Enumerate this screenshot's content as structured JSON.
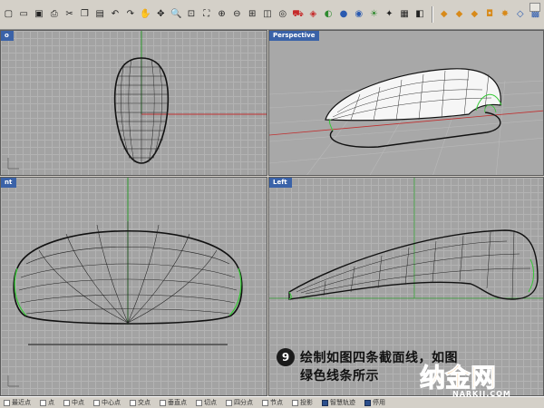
{
  "toolbar": {
    "buttons": [
      {
        "icon": "new-file-icon",
        "glyph": "▢"
      },
      {
        "icon": "open-folder-icon",
        "glyph": "▭"
      },
      {
        "icon": "save-icon",
        "glyph": "▣"
      },
      {
        "icon": "print-icon",
        "glyph": "⎙"
      },
      {
        "icon": "cut-icon",
        "glyph": "✂"
      },
      {
        "icon": "copy-icon",
        "glyph": "❐"
      },
      {
        "icon": "paste-icon",
        "glyph": "▤"
      },
      {
        "icon": "undo-icon",
        "glyph": "↶"
      },
      {
        "icon": "redo-icon",
        "glyph": "↷"
      },
      {
        "icon": "pan-hand-icon",
        "glyph": "✋"
      },
      {
        "icon": "rotate-view-icon",
        "glyph": "✥"
      },
      {
        "icon": "zoom-icon",
        "glyph": "🔍"
      },
      {
        "icon": "zoom-window-icon",
        "glyph": "⊡"
      },
      {
        "icon": "zoom-extents-icon",
        "glyph": "⛶"
      },
      {
        "icon": "zoom-selected-icon",
        "glyph": "⊕"
      },
      {
        "icon": "zoom-out-icon",
        "glyph": "⊖"
      },
      {
        "icon": "grid-icon",
        "glyph": "⊞"
      },
      {
        "icon": "layer-icon",
        "glyph": "◫"
      },
      {
        "icon": "bulb-icon",
        "glyph": "◎"
      },
      {
        "icon": "car-icon",
        "glyph": "⛟"
      },
      {
        "icon": "properties-icon",
        "glyph": "◈"
      },
      {
        "icon": "render-icon",
        "glyph": "◐"
      },
      {
        "icon": "material-icon",
        "glyph": "●"
      },
      {
        "icon": "sphere-icon",
        "glyph": "◉"
      },
      {
        "icon": "light-icon",
        "glyph": "☀"
      },
      {
        "icon": "snap-icon",
        "glyph": "✦"
      },
      {
        "icon": "options-icon",
        "glyph": "▦"
      },
      {
        "icon": "help-icon",
        "glyph": "◧"
      },
      {
        "icon": "osnap-end-icon",
        "glyph": "◆"
      },
      {
        "icon": "osnap-mid-icon",
        "glyph": "◆"
      },
      {
        "icon": "osnap-cen-icon",
        "glyph": "◆"
      },
      {
        "icon": "cylinder-icon",
        "glyph": "◘"
      },
      {
        "icon": "sparkle-icon",
        "glyph": "✸"
      },
      {
        "icon": "diamond-icon",
        "glyph": "◇"
      },
      {
        "icon": "box-icon",
        "glyph": "▩"
      }
    ]
  },
  "viewports": {
    "top_left": {
      "title": "o"
    },
    "top_right": {
      "title": "Perspective"
    },
    "bottom_left": {
      "title": "nt"
    },
    "bottom_right": {
      "title": "Left"
    }
  },
  "caption": {
    "step_number": "9",
    "line1": "绘制如图四条截面线，如图",
    "line2": "绿色线条所示"
  },
  "watermark": {
    "text": "纳金网",
    "url": "NARKII.COM"
  },
  "statusbar": {
    "items": [
      {
        "label": "最近点",
        "checked": false
      },
      {
        "label": "点",
        "checked": false
      },
      {
        "label": "中点",
        "checked": false
      },
      {
        "label": "中心点",
        "checked": false
      },
      {
        "label": "交点",
        "checked": false
      },
      {
        "label": "垂直点",
        "checked": false
      },
      {
        "label": "切点",
        "checked": false
      },
      {
        "label": "四分点",
        "checked": false
      },
      {
        "label": "节点",
        "checked": false
      },
      {
        "label": "投影",
        "checked": false
      },
      {
        "label": "智慧轨迹",
        "checked": true
      },
      {
        "label": "停用",
        "checked": true
      }
    ]
  },
  "colors": {
    "viewport_bg": "#a3a3a3",
    "title_tab": "#3a62a8",
    "x_axis": "#c03030",
    "y_axis": "#2e9a2e",
    "section_curve": "#37c837"
  }
}
